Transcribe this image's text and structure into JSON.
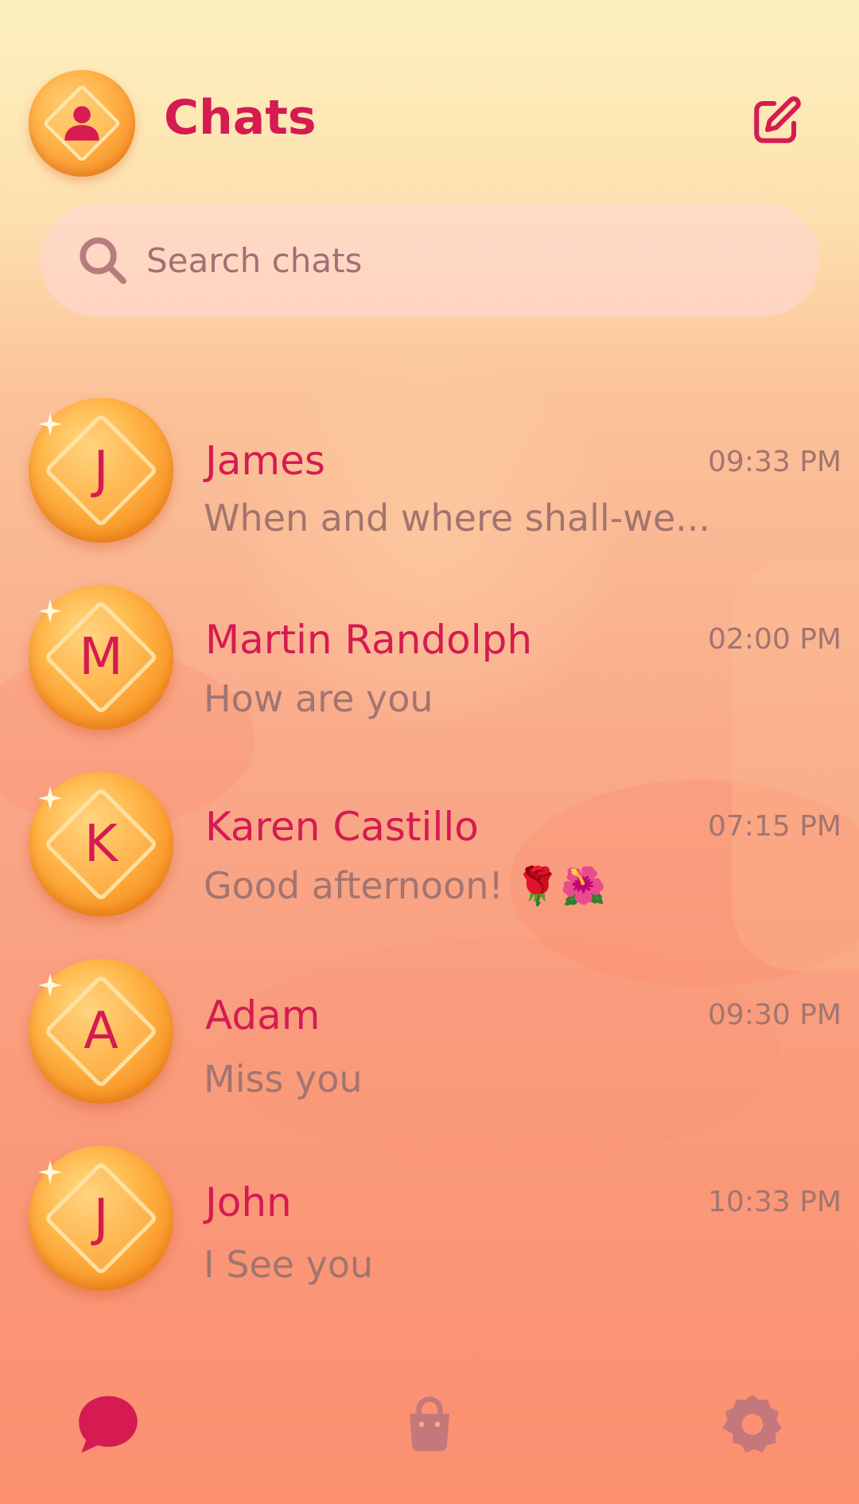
{
  "header": {
    "title": "Chats"
  },
  "search": {
    "placeholder": "Search chats"
  },
  "chats": [
    {
      "initial": "J",
      "name": "James",
      "preview": "When and where shall-we...",
      "time": "09:33 PM"
    },
    {
      "initial": "M",
      "name": "Martin Randolph",
      "preview": "How are you",
      "time": "02:00 PM"
    },
    {
      "initial": "K",
      "name": "Karen Castillo",
      "preview": "Good afternoon! 🌹🌺",
      "time": "07:15 PM"
    },
    {
      "initial": "A",
      "name": "Adam",
      "preview": "Miss you",
      "time": "09:30 PM"
    },
    {
      "initial": "J",
      "name": "John",
      "preview": "I See you",
      "time": "10:33 PM"
    }
  ],
  "icons": {
    "profile": "person-icon",
    "compose": "compose-icon",
    "search": "search-icon",
    "nav": [
      "chat-bubble-icon",
      "shopping-bag-icon",
      "gear-icon"
    ]
  },
  "colors": {
    "accent": "#d51b52",
    "muted": "#a37470",
    "nav_inactive": "#c4787b",
    "coin": "#f7901f"
  }
}
